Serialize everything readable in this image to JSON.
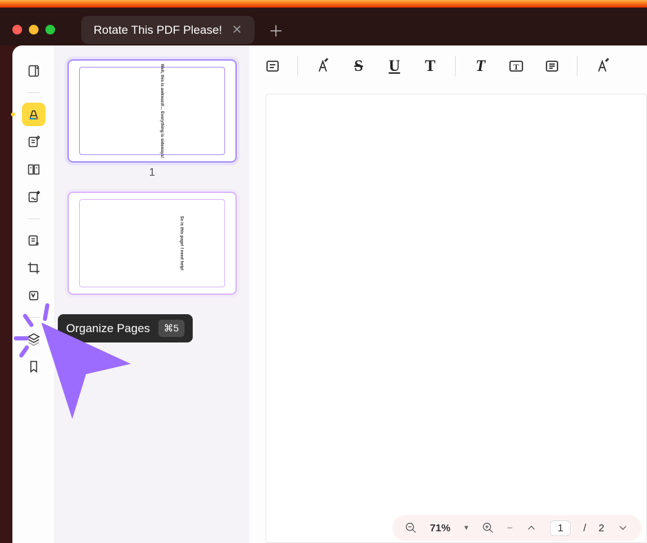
{
  "tab": {
    "title": "Rotate This PDF Please!"
  },
  "thumbnails": [
    {
      "label": "1",
      "text": "Well, this is awkward!...\nEverything is sideways!"
    },
    {
      "label": "",
      "text": "So is this page!\nI need help!"
    }
  ],
  "tooltip": {
    "label": "Organize Pages",
    "shortcut": "⌘5"
  },
  "zoom": {
    "value": "71%"
  },
  "pagination": {
    "current": "1",
    "sep": "/",
    "total": "2"
  },
  "toolbar": {
    "note": "note",
    "highlight": "A",
    "strike": "S",
    "under": "U",
    "textT": "T",
    "textT2": "T",
    "textbox": "T",
    "insert": "≡",
    "marker": "A"
  },
  "colors": {
    "accent": "#9c6bff",
    "active": "#ffd93d"
  }
}
